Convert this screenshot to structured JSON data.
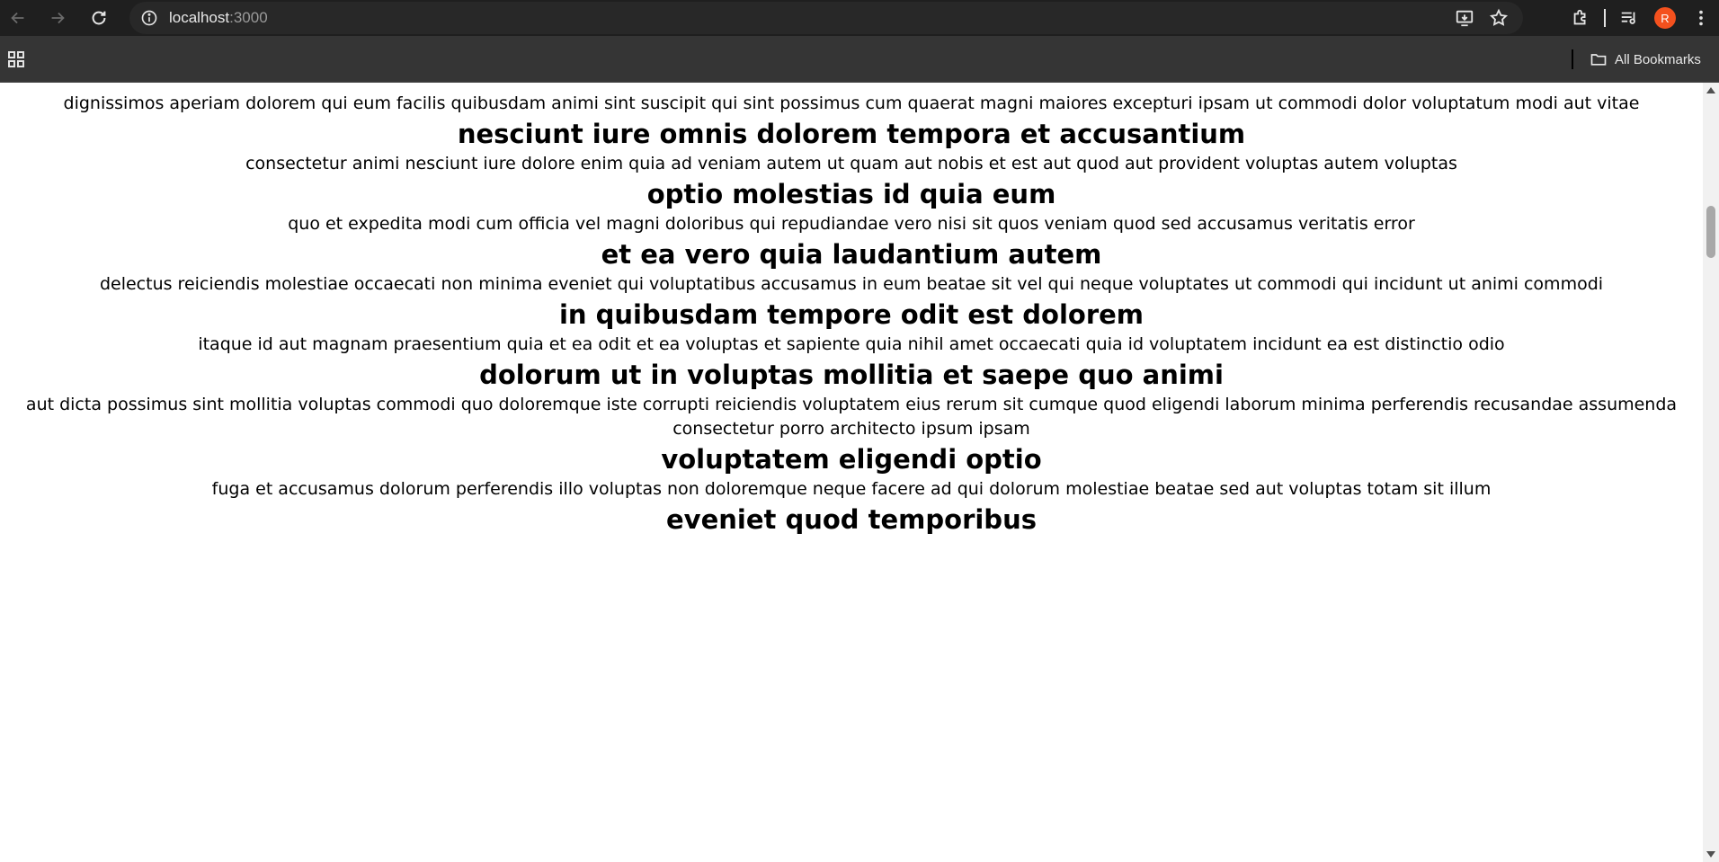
{
  "browser": {
    "url_host": "localhost",
    "url_port": ":3000",
    "bookmarks_label": "All Bookmarks",
    "profile_initial": "R",
    "profile_color": "#f4511e"
  },
  "article": {
    "items": [
      {
        "type": "p",
        "text": "dignissimos aperiam dolorem qui eum facilis quibusdam animi sint suscipit qui sint possimus cum quaerat magni maiores excepturi ipsam ut commodi dolor voluptatum modi aut vitae"
      },
      {
        "type": "h",
        "text": "nesciunt iure omnis dolorem tempora et accusantium"
      },
      {
        "type": "p",
        "text": "consectetur animi nesciunt iure dolore enim quia ad veniam autem ut quam aut nobis et est aut quod aut provident voluptas autem voluptas"
      },
      {
        "type": "h",
        "text": "optio molestias id quia eum"
      },
      {
        "type": "p",
        "text": "quo et expedita modi cum officia vel magni doloribus qui repudiandae vero nisi sit quos veniam quod sed accusamus veritatis error"
      },
      {
        "type": "h",
        "text": "et ea vero quia laudantium autem"
      },
      {
        "type": "p",
        "text": "delectus reiciendis molestiae occaecati non minima eveniet qui voluptatibus accusamus in eum beatae sit vel qui neque voluptates ut commodi qui incidunt ut animi commodi"
      },
      {
        "type": "h",
        "text": "in quibusdam tempore odit est dolorem"
      },
      {
        "type": "p",
        "text": "itaque id aut magnam praesentium quia et ea odit et ea voluptas et sapiente quia nihil amet occaecati quia id voluptatem incidunt ea est distinctio odio"
      },
      {
        "type": "h",
        "text": "dolorum ut in voluptas mollitia et saepe quo animi"
      },
      {
        "type": "p",
        "text": "aut dicta possimus sint mollitia voluptas commodi quo doloremque iste corrupti reiciendis voluptatem eius rerum sit cumque quod eligendi laborum minima perferendis recusandae assumenda consectetur porro architecto ipsum ipsam"
      },
      {
        "type": "h",
        "text": "voluptatem eligendi optio"
      },
      {
        "type": "p",
        "text": "fuga et accusamus dolorum perferendis illo voluptas non doloremque neque facere ad qui dolorum molestiae beatae sed aut voluptas totam sit illum"
      },
      {
        "type": "h",
        "text": "eveniet quod temporibus"
      }
    ]
  }
}
